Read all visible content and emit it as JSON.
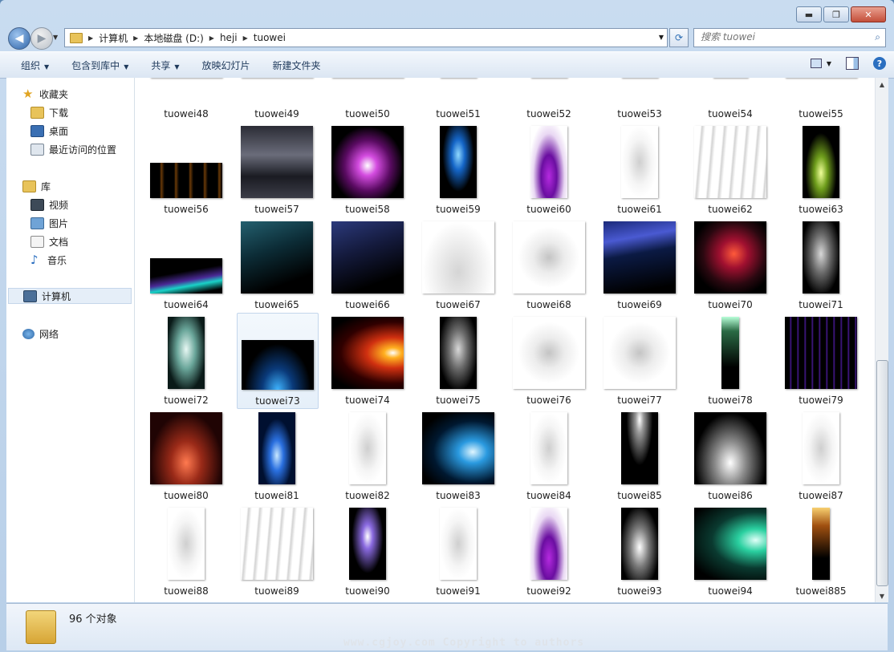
{
  "window": {
    "minimize": "▬",
    "maximize": "❐",
    "close": "✕"
  },
  "address": {
    "path": [
      "计算机",
      "本地磁盘 (D:)",
      "heji",
      "tuowei"
    ]
  },
  "search": {
    "placeholder": "搜索 tuowei"
  },
  "toolbar": {
    "organize": "组织",
    "include": "包含到库中",
    "share": "共享",
    "slideshow": "放映幻灯片",
    "newfolder": "新建文件夹"
  },
  "nav": {
    "favorites": "收藏夹",
    "downloads": "下载",
    "desktop": "桌面",
    "recent": "最近访问的位置",
    "libraries": "库",
    "videos": "视频",
    "pictures": "图片",
    "documents": "文档",
    "music": "音乐",
    "computer": "计算机",
    "network": "网络"
  },
  "files": [
    {
      "name": "tuowei48",
      "style": "lightning-red"
    },
    {
      "name": "tuowei49",
      "style": "streak-gold"
    },
    {
      "name": "tuowei50",
      "style": "streak-teal"
    },
    {
      "name": "tuowei51",
      "style": "wisp"
    },
    {
      "name": "tuowei52",
      "style": "wisp"
    },
    {
      "name": "tuowei53",
      "style": "wisp"
    },
    {
      "name": "tuowei54",
      "style": "fire-bar"
    },
    {
      "name": "tuowei55",
      "style": "smoke-dark"
    },
    {
      "name": "tuowei56",
      "style": "flames-row"
    },
    {
      "name": "tuowei57",
      "style": "clouds-dark"
    },
    {
      "name": "tuowei58",
      "style": "magenta-flare"
    },
    {
      "name": "tuowei59",
      "style": "blue-lightning"
    },
    {
      "name": "tuowei60",
      "style": "violet-flame"
    },
    {
      "name": "tuowei61",
      "style": "wisp"
    },
    {
      "name": "tuowei62",
      "style": "wisp-lines"
    },
    {
      "name": "tuowei63",
      "style": "green-flame"
    },
    {
      "name": "tuowei64",
      "style": "aurora"
    },
    {
      "name": "tuowei65",
      "style": "teal-dark"
    },
    {
      "name": "tuowei66",
      "style": "navy-dark"
    },
    {
      "name": "tuowei67",
      "style": "spiky"
    },
    {
      "name": "tuowei68",
      "style": "feather"
    },
    {
      "name": "tuowei69",
      "style": "electric-blue"
    },
    {
      "name": "tuowei70",
      "style": "red-smoke"
    },
    {
      "name": "tuowei71",
      "style": "gray-smoke"
    },
    {
      "name": "tuowei72",
      "style": "teal-smoke"
    },
    {
      "name": "tuowei73",
      "style": "blue-glow"
    },
    {
      "name": "tuowei74",
      "style": "orange-burst"
    },
    {
      "name": "tuowei75",
      "style": "gray-smoke"
    },
    {
      "name": "tuowei76",
      "style": "feather"
    },
    {
      "name": "tuowei77",
      "style": "feather"
    },
    {
      "name": "tuowei78",
      "style": "green-beam"
    },
    {
      "name": "tuowei79",
      "style": "purple-lines"
    },
    {
      "name": "tuowei80",
      "style": "red-fire"
    },
    {
      "name": "tuowei81",
      "style": "blue-flame"
    },
    {
      "name": "tuowei82",
      "style": "wisp"
    },
    {
      "name": "tuowei83",
      "style": "blue-streak"
    },
    {
      "name": "tuowei84",
      "style": "wisp"
    },
    {
      "name": "tuowei85",
      "style": "white-beam"
    },
    {
      "name": "tuowei86",
      "style": "white-flames"
    },
    {
      "name": "tuowei87",
      "style": "wisp"
    },
    {
      "name": "tuowei88",
      "style": "wisp"
    },
    {
      "name": "tuowei89",
      "style": "wisp-lines"
    },
    {
      "name": "tuowei90",
      "style": "purple-beam"
    },
    {
      "name": "tuowei91",
      "style": "wisp"
    },
    {
      "name": "tuowei92",
      "style": "violet-flame"
    },
    {
      "name": "tuowei93",
      "style": "white-smoke"
    },
    {
      "name": "tuowei94",
      "style": "green-glow"
    },
    {
      "name": "tuowei885",
      "style": "gold-beam"
    }
  ],
  "selected": "tuowei73",
  "status": {
    "count": "96 个对象"
  },
  "watermark": "www.cgjoy.com  Copyright to authors",
  "colors": {
    "accent": "#2b6fc0",
    "selection": "#e5eff9"
  }
}
